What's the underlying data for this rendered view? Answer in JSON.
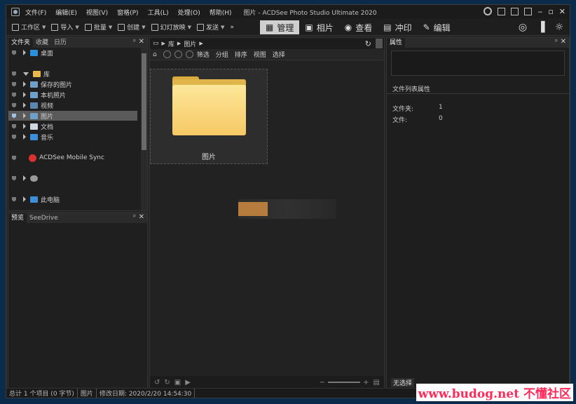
{
  "window": {
    "menu": [
      "文件(F)",
      "编辑(E)",
      "视图(V)",
      "窗格(P)",
      "工具(L)",
      "处理(O)",
      "帮助(H)"
    ],
    "title": "图片 - ACDSee Photo Studio Ultimate 2020"
  },
  "toolbar": {
    "items": [
      "工作区",
      "导入",
      "批量",
      "创建",
      "幻灯放映",
      "发送"
    ],
    "modes": [
      "管理",
      "相片",
      "查看",
      "冲印",
      "编辑"
    ]
  },
  "left_panel": {
    "tabs": [
      "文件夹",
      "收藏",
      "日历"
    ],
    "tree": [
      {
        "label": "桌面"
      },
      {
        "label": "库"
      },
      {
        "label": "保存的图片"
      },
      {
        "label": "本机照片"
      },
      {
        "label": "视频"
      },
      {
        "label": "图片"
      },
      {
        "label": "文档"
      },
      {
        "label": "音乐"
      },
      {
        "label": "ACDSee Mobile Sync"
      },
      {
        "label": ""
      },
      {
        "label": "此电脑"
      }
    ]
  },
  "preview_panel": {
    "tabs": [
      "预览",
      "SeeDrive"
    ]
  },
  "center": {
    "path": [
      "库",
      "图片"
    ],
    "filters": [
      "筛选",
      "分组",
      "排序",
      "视图",
      "选择"
    ],
    "thumbnail_label": "图片"
  },
  "right_panel": {
    "tab": "属性",
    "header": "文件列表属性",
    "rows": [
      {
        "label": "文件夹:",
        "value": "1"
      },
      {
        "label": "文件:",
        "value": "0"
      }
    ],
    "no_selection": "无选择"
  },
  "statusbar": {
    "total": "总计 1 个项目 (0 字节)",
    "folder": "图片",
    "modified": "修改日期: 2020/2/20 14:54:30"
  },
  "watermark": "www.budog.net 不懂社区",
  "colors": {
    "accent": "#f6c964",
    "selection": "#5a5a5a",
    "watermark": "#ff2a5a"
  }
}
